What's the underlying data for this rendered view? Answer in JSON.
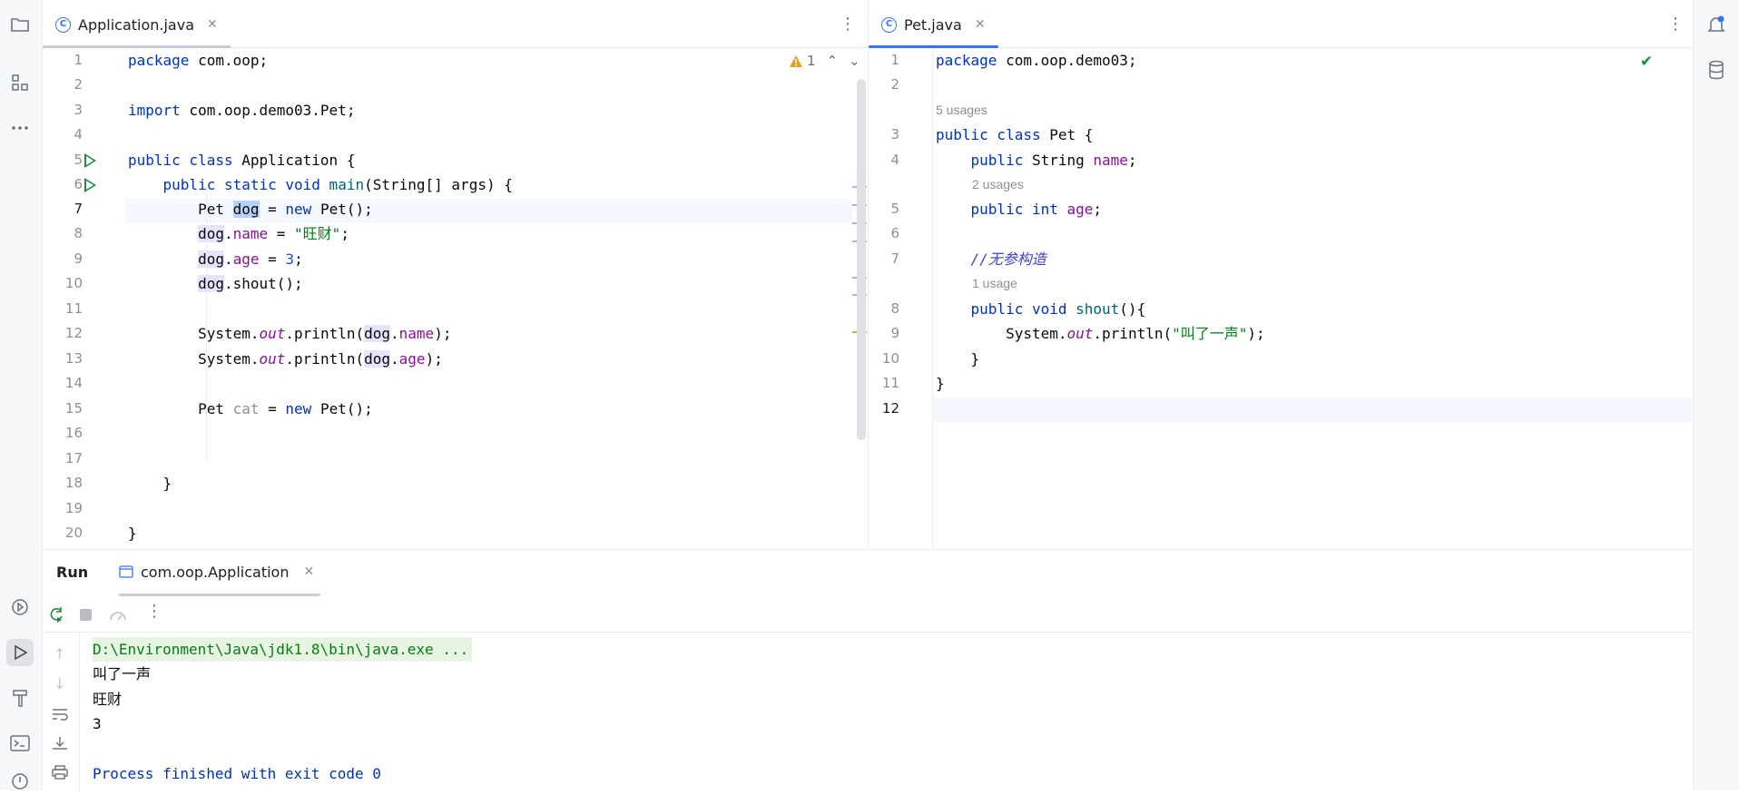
{
  "editor_left": {
    "tab_label": "Application.java",
    "warning_count": "1",
    "line_numbers": [
      "1",
      "2",
      "3",
      "4",
      "5",
      "6",
      "7",
      "8",
      "9",
      "10",
      "11",
      "12",
      "13",
      "14",
      "15",
      "16",
      "17",
      "18",
      "19",
      "20"
    ],
    "code": {
      "l1_kw": "package",
      "l1_rest": " com.oop;",
      "l3_kw": "import",
      "l3_rest": " com.oop.demo03.Pet;",
      "l5_kw": "public class",
      "l5_rest": " Application {",
      "l6_indent": "    ",
      "l6_kw": "public static void",
      "l6_fn": " main",
      "l6_rest": "(String[] args) {",
      "l7_a": "        Pet ",
      "l7_sel": "dog",
      "l7_b": " = ",
      "l7_kw": "new",
      "l7_c": " Pet();",
      "l8_indent": "        ",
      "l8_var": "dog",
      "l8_dot": ".",
      "l8_fld": "name",
      "l8_eq": " = ",
      "l8_str": "\"旺财\"",
      "l8_end": ";",
      "l9_indent": "        ",
      "l9_var": "dog",
      "l9_dot": ".",
      "l9_fld": "age",
      "l9_eq": " = ",
      "l9_num": "3",
      "l9_end": ";",
      "l10_indent": "        ",
      "l10_var": "dog",
      "l10_rest": ".shout();",
      "l12_a": "        System.",
      "l12_out": "out",
      "l12_b": ".println(",
      "l12_var": "dog",
      "l12_dot": ".",
      "l12_fld": "name",
      "l12_end": ");",
      "l13_a": "        System.",
      "l13_out": "out",
      "l13_b": ".println(",
      "l13_var": "dog",
      "l13_dot": ".",
      "l13_fld": "age",
      "l13_end": ");",
      "l15_a": "        Pet ",
      "l15_unused": "cat",
      "l15_b": " = ",
      "l15_kw": "new",
      "l15_c": " Pet();",
      "l18": "    }",
      "l20": "}"
    }
  },
  "editor_right": {
    "tab_label": "Pet.java",
    "line_numbers": [
      "1",
      "2",
      "3",
      "4",
      "5",
      "6",
      "7",
      "8",
      "9",
      "10",
      "11",
      "12"
    ],
    "hints": {
      "h1": "5 usages",
      "h2": "2 usages",
      "h3": "1 usage"
    },
    "code": {
      "l1_kw": "package",
      "l1_rest": " com.oop.demo03;",
      "l3_kw": "public class",
      "l3_rest": " Pet {",
      "l4_indent": "    ",
      "l4_kw": "public",
      "l4_a": " String ",
      "l4_fld": "name",
      "l4_end": ";",
      "l5_indent": "    ",
      "l5_kw": "public int",
      "l5_a": " ",
      "l5_fld": "age",
      "l5_end": ";",
      "l7_indent": "    ",
      "l7_cm": "//无参构造",
      "l8_indent": "    ",
      "l8_kw": "public void",
      "l8_fn": " shout",
      "l8_end": "(){",
      "l9_a": "        System.",
      "l9_out": "out",
      "l9_b": ".println(",
      "l9_str": "\"叫了一声\"",
      "l9_end": ");",
      "l10": "    }",
      "l11": "}"
    }
  },
  "run_panel": {
    "title": "Run",
    "config_tab": "com.oop.Application",
    "console": {
      "cmd": "D:\\Environment\\Java\\jdk1.8\\bin\\java.exe ...",
      "out1": "叫了一声",
      "out2": "旺财",
      "out3": "3",
      "exit": "Process finished with exit code 0"
    }
  },
  "colors": {
    "accent": "#3574f0",
    "keyword": "#0033b3",
    "field": "#871094",
    "string": "#067d17",
    "run_green": "#208a3c"
  }
}
